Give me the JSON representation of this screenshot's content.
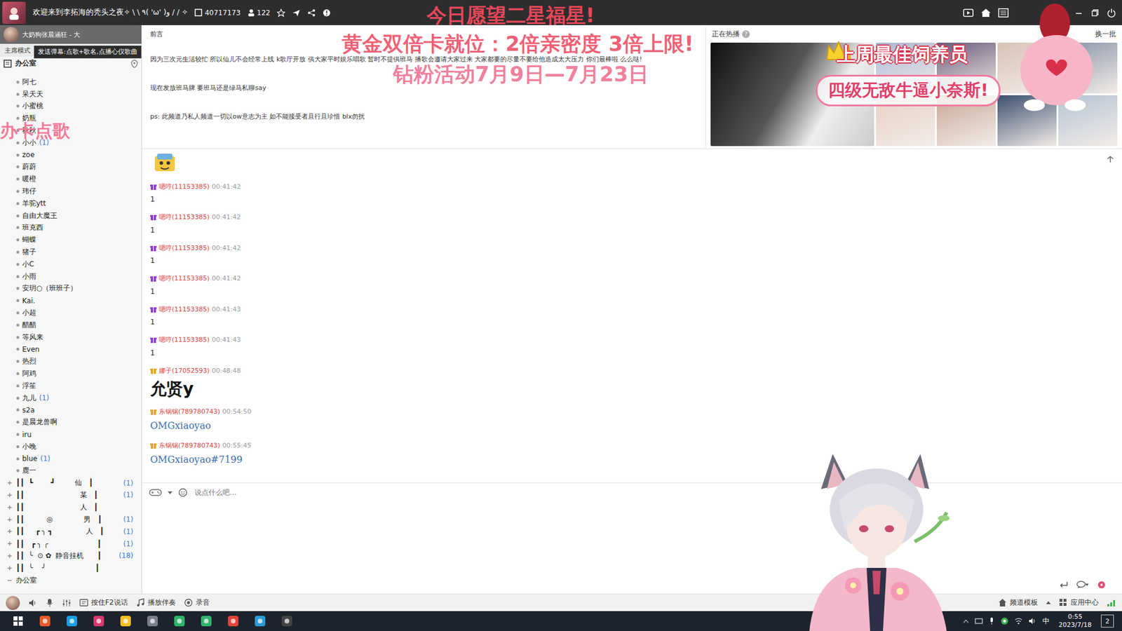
{
  "window": {
    "title": "欢迎来到李拓海的秃头之夜✧ \\ \\ ٩( 'ω' )و / / ✧",
    "online_count": "40717173",
    "user_count": "122"
  },
  "overlays": {
    "wish": "今日愿望二星福星!",
    "gold": "黄金双倍卡就位：2倍亲密度  3倍上限!",
    "diamond": "钻粉活动7月9日—7月23日",
    "song_card": "办卡点歌",
    "best_keeper": "上周最佳饲养员",
    "nickname": "四级无敌牛逼小奈斯!"
  },
  "sidebar": {
    "user": "大奶狗张晨涵狂 - 大",
    "tooltip": "发送弹幕:点歌+歌名,点播心仪歌曲",
    "mode": "主席模式",
    "channel": "办公室",
    "members": [
      {
        "name": "阿七"
      },
      {
        "name": "呆天天"
      },
      {
        "name": "小蜜桃"
      },
      {
        "name": "奶瓶"
      },
      {
        "name": "秋秋"
      },
      {
        "name": "小小",
        "count": "(1)"
      },
      {
        "name": "zoe"
      },
      {
        "name": "蔚蔚"
      },
      {
        "name": "暖橙"
      },
      {
        "name": "玮仔"
      },
      {
        "name": "羊驼ytt"
      },
      {
        "name": "自由大魔王"
      },
      {
        "name": "班克西"
      },
      {
        "name": "蝴蝶"
      },
      {
        "name": "猪子"
      },
      {
        "name": "小C"
      },
      {
        "name": "小雨"
      },
      {
        "name": "安玥○（班班子）"
      },
      {
        "name": "Kai."
      },
      {
        "name": "小超"
      },
      {
        "name": "醋醋"
      },
      {
        "name": "等风来"
      },
      {
        "name": "Even"
      },
      {
        "name": "热烈"
      },
      {
        "name": "阿鸡"
      },
      {
        "name": "浮笙"
      },
      {
        "name": "九儿",
        "count": "(1)"
      },
      {
        "name": "s2a"
      },
      {
        "name": "是晨龙兽啊"
      },
      {
        "name": "iru"
      },
      {
        "name": "小晚"
      },
      {
        "name": "blue",
        "count": "(1)"
      },
      {
        "name": "鹿一"
      }
    ],
    "subchannels": [
      {
        "name": "┃┃  ┗        ┛         仙   ┃",
        "count": "(1)"
      },
      {
        "name": "┃┃                         某   ┃",
        "count": "(1)"
      },
      {
        "name": "┃┃                         人   ┃"
      },
      {
        "name": "┃┃          ◎              男   ┃",
        "count": "(1)"
      },
      {
        "name": "┃┃     ┏ ╮ ┓               人   ┃",
        "count": "(1)"
      },
      {
        "name": "┃┃   ┏ ╮ ╭                      ┃",
        "count": "(1)"
      },
      {
        "name": "┃┃  ╰  ⊙ ✿  静音挂机      ┃",
        "count": "(18)"
      },
      {
        "name": "┃┃  ╰    ╯                      ┃"
      }
    ],
    "footer": "办公室"
  },
  "announcement": {
    "label": "前言",
    "lines": [
      "因为三次元生活较忙 所以仙儿不会经常上线 k歌厅开放 供大家平时娱乐唱歌 暂时不提供班马 播歌会邀请大家过来 大家都要的尽量不要给他造成太大压力 你们最棒啦 么么哒!",
      "现在发放班马牌 要班马还是绿马私聊say",
      "ps: 此频道乃私人频道一切以ow意志为主 如不能接受者且行且珍惜 blx勿扰"
    ]
  },
  "live": {
    "title": "正在热播",
    "help": "?",
    "refresh": "换一批"
  },
  "messages": [
    {
      "kind": "sticker"
    },
    {
      "kind": "plain",
      "user": "嗯哼(11153385)",
      "time": "00:41:42",
      "text": "1",
      "color": "#8e3fd1"
    },
    {
      "kind": "plain",
      "user": "嗯哼(11153385)",
      "time": "00:41:42",
      "text": "1",
      "color": "#8e3fd1"
    },
    {
      "kind": "plain",
      "user": "嗯哼(11153385)",
      "time": "00:41:42",
      "text": "1",
      "color": "#8e3fd1"
    },
    {
      "kind": "plain",
      "user": "嗯哼(11153385)",
      "time": "00:41:42",
      "text": "1",
      "color": "#8e3fd1"
    },
    {
      "kind": "plain",
      "user": "嗯哼(11153385)",
      "time": "00:41:43",
      "text": "1",
      "color": "#8e3fd1"
    },
    {
      "kind": "plain",
      "user": "嗯哼(11153385)",
      "time": "00:41:43",
      "text": "1",
      "color": "#8e3fd1"
    },
    {
      "kind": "big",
      "user": "娜子(17052593)",
      "time": "00:48:48",
      "text": "允贤y",
      "color": "#e6a817"
    },
    {
      "kind": "link",
      "user": "东锅锅(789780743)",
      "time": "00:54:50",
      "text": "OMGxiaoyao",
      "color": "#e6a817"
    },
    {
      "kind": "link",
      "user": "东锅锅(789780743)",
      "time": "00:55:45",
      "text": "OMGxiaoyao#7199",
      "color": "#e6a817"
    }
  ],
  "input": {
    "placeholder": "说点什么吧..."
  },
  "toolbar": {
    "ptt": "按住F2说话",
    "accompany": "播放伴奏",
    "record": "录音",
    "template": "频道模板",
    "apps": "应用中心"
  },
  "taskbar": {
    "ime": "中",
    "time": "0:55",
    "date": "2023/7/18",
    "notifications": "2"
  }
}
